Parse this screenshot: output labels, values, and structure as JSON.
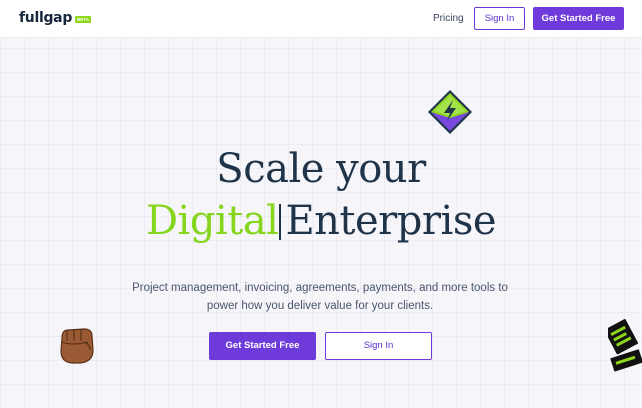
{
  "nav": {
    "brand": "fullgap",
    "brand_badge": "BETA",
    "pricing": "Pricing",
    "sign_in": "Sign In",
    "get_started": "Get Started Free"
  },
  "hero": {
    "line1": "Scale your",
    "accent": "Digital",
    "line2_rest": "Enterprise",
    "subtitle_line1": "Project management, invoicing, agreements, payments, and more tools to",
    "subtitle_line2": "power how you deliver value for your clients.",
    "cta_primary": "Get Started Free",
    "cta_secondary": "Sign In"
  },
  "decorations": {
    "top_right": "lightning-diamond-icon",
    "bottom_left": "raised-fist-icon",
    "bottom_right": "sticker-icon"
  },
  "colors": {
    "primary": "#6e3ad9",
    "accent_green": "#85d61c",
    "heading": "#1f3349",
    "background": "#f6f5fa"
  }
}
